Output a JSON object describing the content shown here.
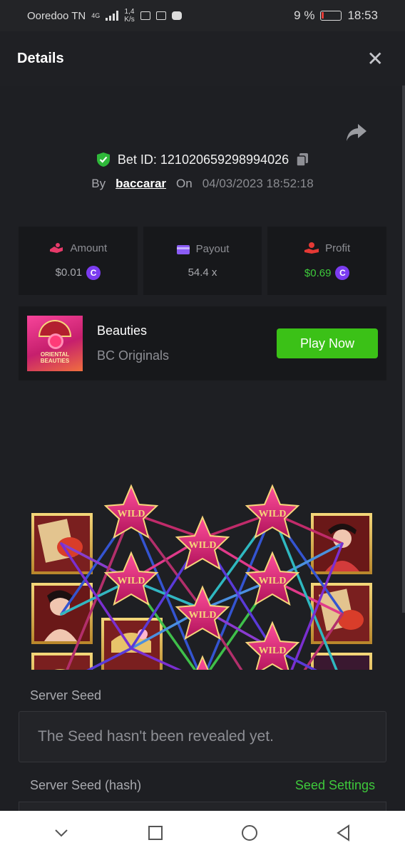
{
  "status": {
    "carrier": "Ooredoo TN",
    "network": "4G",
    "speed_value": "1,4",
    "speed_unit": "K/s",
    "battery": "9 %",
    "time": "18:53"
  },
  "header": {
    "title": "Details",
    "close_icon": "close-icon"
  },
  "bet": {
    "id_label": "Bet ID: 121020659298994026",
    "by_label": "By",
    "user": "baccarar",
    "on_label": "On",
    "datetime": "04/03/2023 18:52:18"
  },
  "stats": {
    "amount_label": "Amount",
    "amount_value": "$0.01",
    "payout_label": "Payout",
    "payout_value": "54.4 x",
    "profit_label": "Profit",
    "profit_value": "$0.69",
    "coin_glyph": "C"
  },
  "game": {
    "name": "Beauties",
    "provider": "BC Originals",
    "play_label": "Play Now",
    "thumb_text": "ORIENTAL BEAUTIES"
  },
  "grid": {
    "wild_text": "WILD"
  },
  "seed": {
    "server_seed_label": "Server Seed",
    "server_seed_value": "The Seed hasn't been revealed yet.",
    "hash_label": "Server Seed (hash)",
    "settings_label": "Seed Settings"
  },
  "colors": {
    "accent_green": "#3bc117",
    "coin_purple": "#7b3cf0",
    "profit_green": "#3ec93b"
  }
}
